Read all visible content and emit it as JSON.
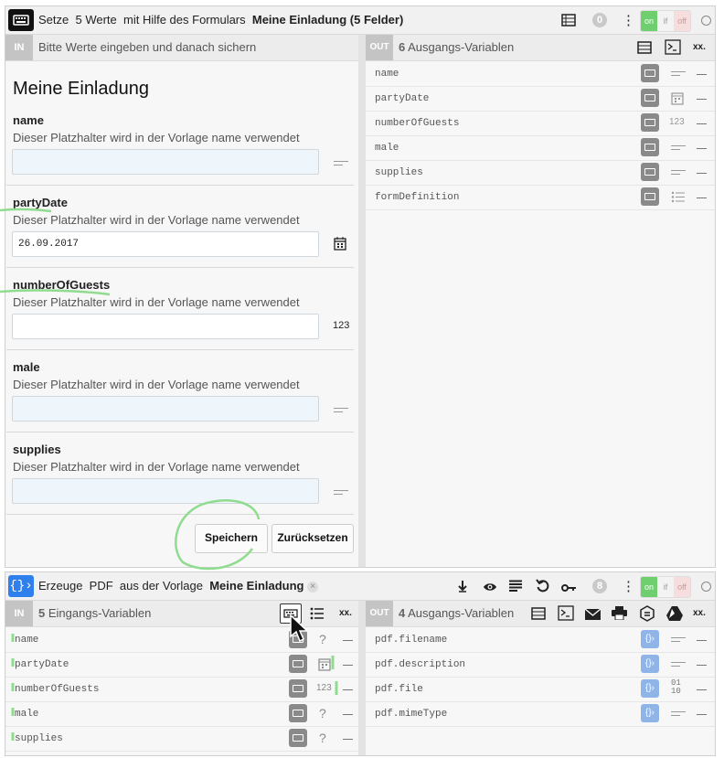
{
  "form_block": {
    "header": {
      "prefix": "Setze",
      "count": "5 Werte",
      "middle": "mit Hilfe des Formulars",
      "form_name": "Meine Einladung (5 Felder)",
      "badge": "0",
      "on": "on",
      "if": "if",
      "off": "off"
    },
    "in": {
      "tag": "IN",
      "text": "Bitte Werte eingeben und danach sichern"
    },
    "form_title": "Meine Einladung",
    "fields": [
      {
        "name": "name",
        "desc": "Dieser Platzhalter wird in der Vorlage name verwendet",
        "value": "",
        "type_icon": "text-lines-icon"
      },
      {
        "name": "partyDate",
        "desc": "Dieser Platzhalter wird in der Vorlage name verwendet",
        "value": "26.09.2017",
        "type_icon": "calendar-icon"
      },
      {
        "name": "numberOfGuests",
        "desc": "Dieser Platzhalter wird in der Vorlage name verwendet",
        "value": "",
        "type_label": "123"
      },
      {
        "name": "male",
        "desc": "Dieser Platzhalter wird in der Vorlage name verwendet",
        "value": "",
        "type_icon": "text-lines-icon"
      },
      {
        "name": "supplies",
        "desc": "Dieser Platzhalter wird in der Vorlage name verwendet",
        "value": "",
        "type_icon": "text-lines-icon"
      }
    ],
    "save_label": "Speichern",
    "reset_label": "Zurücksetzen",
    "out": {
      "tag": "OUT",
      "count": "6",
      "label": "Ausgangs-Variablen",
      "xx": "xx.",
      "vars": [
        {
          "name": "name",
          "type": "text"
        },
        {
          "name": "partyDate",
          "type": "date"
        },
        {
          "name": "numberOfGuests",
          "type": "number",
          "type_label": "123"
        },
        {
          "name": "male",
          "type": "text"
        },
        {
          "name": "supplies",
          "type": "text"
        },
        {
          "name": "formDefinition",
          "type": "list"
        }
      ]
    }
  },
  "pdf_block": {
    "header": {
      "prefix": "Erzeuge",
      "kind": "PDF",
      "middle": "aus der Vorlage",
      "template": "Meine Einladung",
      "badge": "8",
      "on": "on",
      "if": "if",
      "off": "off"
    },
    "in": {
      "tag": "IN",
      "count": "5",
      "label": "Eingangs-Variablen",
      "xx": "xx.",
      "vars": [
        {
          "name": "name",
          "type": "unknown",
          "type_label": "?"
        },
        {
          "name": "partyDate",
          "type": "date"
        },
        {
          "name": "numberOfGuests",
          "type": "number",
          "type_label": "123"
        },
        {
          "name": "male",
          "type": "unknown",
          "type_label": "?"
        },
        {
          "name": "supplies",
          "type": "unknown",
          "type_label": "?"
        }
      ]
    },
    "out": {
      "tag": "OUT",
      "count": "4",
      "label": "Ausgangs-Variablen",
      "xx": "xx.",
      "vars": [
        {
          "name": "pdf.filename",
          "type": "text"
        },
        {
          "name": "pdf.description",
          "type": "text"
        },
        {
          "name": "pdf.file",
          "type": "binary",
          "type_label": "01\n10"
        },
        {
          "name": "pdf.mimeType",
          "type": "text"
        }
      ]
    }
  },
  "colors": {
    "on_green": "#6fcf6f",
    "off_red": "#e9a7a7",
    "pdf_blue": "#2f80ed",
    "scribble_green": "#8fdc8f"
  }
}
